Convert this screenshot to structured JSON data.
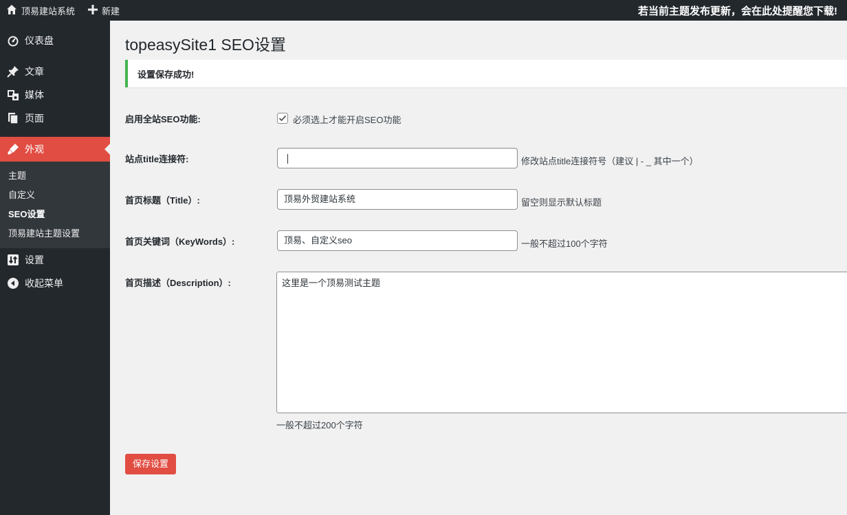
{
  "adminbar": {
    "site_name": "顶易建站系统",
    "new_label": "新建",
    "update_notice": "若当前主题发布更新，会在此处提醒您下载!"
  },
  "sidebar": {
    "items": [
      {
        "label": "仪表盘",
        "icon": "dashboard-icon"
      },
      {
        "label": "文章",
        "icon": "pin-icon"
      },
      {
        "label": "媒体",
        "icon": "media-icon"
      },
      {
        "label": "页面",
        "icon": "pages-icon"
      },
      {
        "label": "外观",
        "icon": "appearance-icon"
      }
    ],
    "submenu": [
      "主题",
      "自定义",
      "SEO设置",
      "顶易建站主题设置"
    ],
    "bottom_items": [
      {
        "label": "设置",
        "icon": "settings-icon"
      },
      {
        "label": "收起菜单",
        "icon": "collapse-icon"
      }
    ]
  },
  "page": {
    "title": "topeasySite1 SEO设置",
    "notice": "设置保存成功!"
  },
  "form": {
    "seo_enable": {
      "label": "启用全站SEO功能:",
      "checked": true,
      "checkbox_label": "必须选上才能开启SEO功能"
    },
    "title_separator": {
      "label": "站点title连接符:",
      "value": "",
      "hint": "修改站点title连接符号（建议 | - _ 其中一个）"
    },
    "home_title": {
      "label": "首页标题（Title）:",
      "value": "顶易外贸建站系统",
      "hint": "留空则显示默认标题"
    },
    "home_keywords": {
      "label": "首页关键词（KeyWords）:",
      "value": "顶易、自定义seo",
      "hint": "一般不超过100个字符"
    },
    "home_description": {
      "label": "首页描述（Description）:",
      "value": "这里是一个顶易测试主题",
      "hint": "一般不超过200个字符"
    },
    "save_button": "保存设置"
  },
  "colors": {
    "accent": "#e14d43",
    "sidebar_bg": "#23282d",
    "submenu_bg": "#32373c",
    "notice_border": "#46b450"
  }
}
